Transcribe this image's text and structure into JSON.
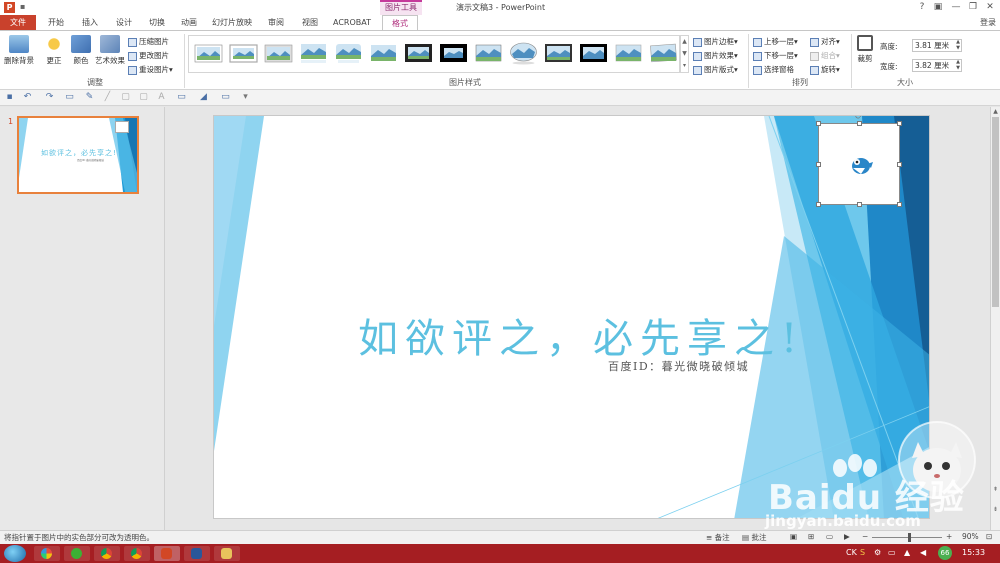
{
  "titlebar": {
    "context_tool_label": "图片工具",
    "window_title": "演示文稿3 - PowerPoint",
    "help": "?",
    "minimize": "—",
    "restore": "❐",
    "close": "✕"
  },
  "tabs": [
    {
      "label": "文件"
    },
    {
      "label": "开始"
    },
    {
      "label": "插入"
    },
    {
      "label": "设计"
    },
    {
      "label": "切换"
    },
    {
      "label": "动画"
    },
    {
      "label": "幻灯片放映"
    },
    {
      "label": "审阅"
    },
    {
      "label": "视图"
    },
    {
      "label": "ACROBAT"
    },
    {
      "label": "格式"
    }
  ],
  "signin": "登录",
  "ribbon": {
    "adjust": {
      "remove_bg": "删除背景",
      "corrections": "更正",
      "color": "颜色",
      "artistic": "艺术效果",
      "compress": "压缩图片",
      "change": "更改图片",
      "reset": "重设图片",
      "label": "调整"
    },
    "styles": {
      "label": "图片样式",
      "border": "图片边框",
      "effects": "图片效果",
      "layout": "图片版式"
    },
    "arrange": {
      "bring_forward": "上移一层",
      "send_backward": "下移一层",
      "selection_pane": "选择窗格",
      "align": "对齐",
      "group": "组合",
      "rotate": "旋转",
      "label": "排列"
    },
    "size": {
      "crop": "裁剪",
      "height_label": "高度:",
      "height_value": "3.81 厘米",
      "width_label": "宽度:",
      "width_value": "3.82 厘米",
      "label": "大小"
    }
  },
  "thumbnail": {
    "number": "1",
    "title": "如欲评之，必先享之!",
    "subtitle": "百度ID: 暮光微晓破倾城"
  },
  "slide": {
    "title": "如欲评之，必先享之!",
    "subtitle": "百度ID：暮光微晓破倾城"
  },
  "watermark": {
    "logo_text": "Baidu 经验",
    "url": "jingyan.baidu.com"
  },
  "statusbar": {
    "hint": "将指针置于图片中的实色部分可改为透明色。",
    "notes": "备注",
    "comments": "批注",
    "zoom": "90%"
  },
  "taskbar": {
    "ime": "CK",
    "badge": "66",
    "time": "15:33"
  },
  "colors": {
    "accent_file": "#c9412c",
    "context_tab": "#c53a9b",
    "slide_title": "#5cc0e0",
    "taskbar": "#a51e22"
  }
}
